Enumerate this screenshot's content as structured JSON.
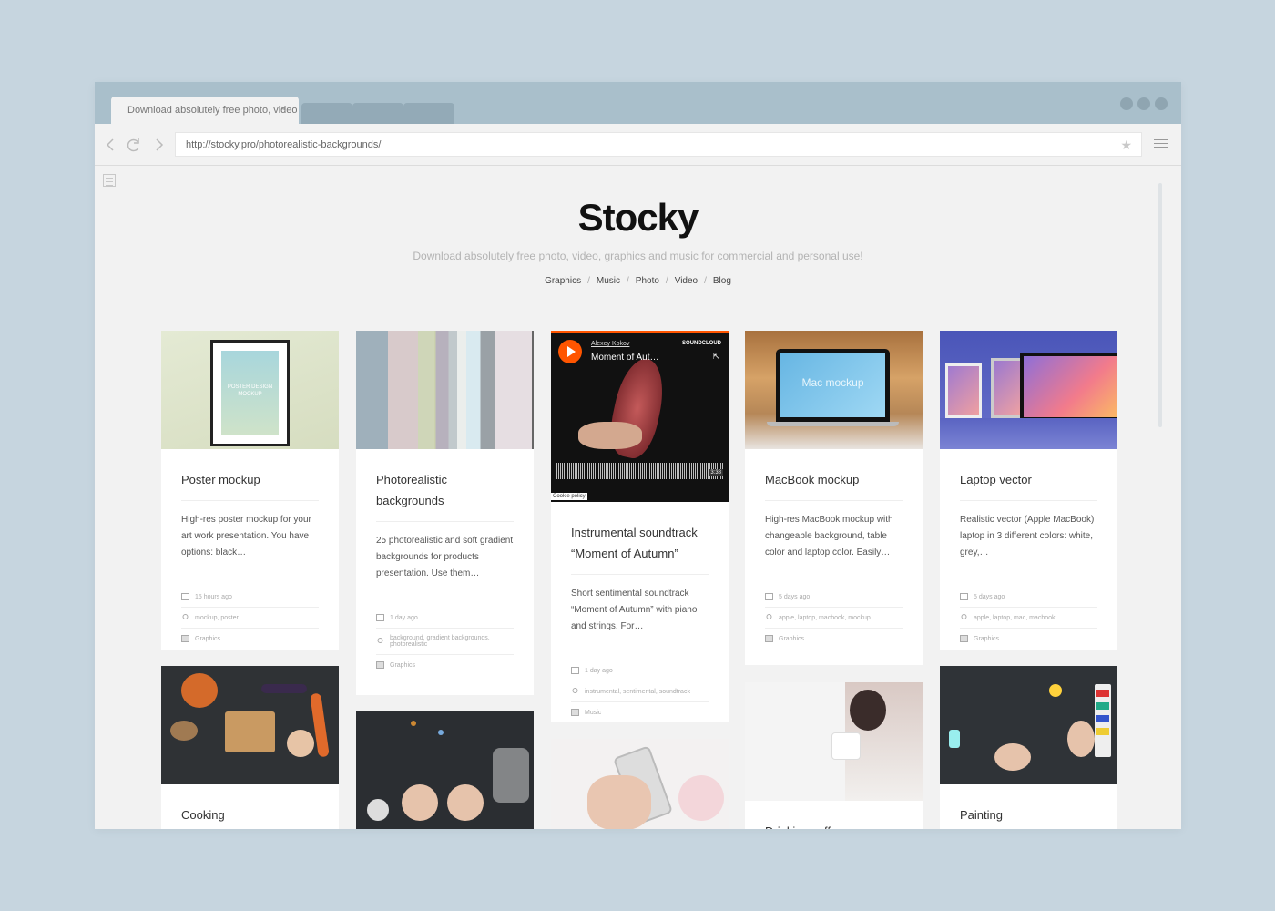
{
  "browser": {
    "tab_title": "Download absolutely free photo, video",
    "tab_close": "×",
    "url": "http://stocky.pro/photorealistic-backgrounds/"
  },
  "site": {
    "title": "Stocky",
    "tagline": "Download absolutely free photo, video, graphics and music for commercial and personal use!",
    "nav": [
      "Graphics",
      "Music",
      "Photo",
      "Video",
      "Blog"
    ],
    "nav_separator": "/"
  },
  "cards": [
    {
      "title": "Poster mockup",
      "desc": "High-res poster mockup for your art work presentation. You have options: black…",
      "time": "15 hours ago",
      "tags": "mockup, poster",
      "category": "Graphics",
      "poster_text_1": "POSTER DESIGN",
      "poster_text_2": "MOCKUP"
    },
    {
      "title": "Photorealistic backgrounds",
      "desc": "25 photorealistic and soft gradient backgrounds for products presentation. Use them…",
      "time": "1 day ago",
      "tags": "background, gradient backgrounds, photorealistic",
      "category": "Graphics"
    },
    {
      "title": "Instrumental soundtrack “Moment of Autumn”",
      "desc": "Short sentimental soundtrack “Moment of Autumn” with piano and strings. For…",
      "time": "1 day ago",
      "tags": "instrumental, sentimental, soundtrack",
      "category": "Music",
      "player": {
        "artist": "Alexey Kokov",
        "track": "Moment of Aut…",
        "brand": "SOUNDCLOUD",
        "duration": "3:38",
        "cookie": "Cookie policy"
      }
    },
    {
      "title": "MacBook mockup",
      "desc": "High-res MacBook mockup with changeable background, table color and laptop color. Easily…",
      "time": "5 days ago",
      "tags": "apple, laptop, macbook, mockup",
      "category": "Graphics",
      "screen_text": "Mac mockup"
    },
    {
      "title": "Laptop vector",
      "desc": "Realistic vector (Apple MacBook) laptop in 3 different colors: white, grey,…",
      "time": "5 days ago",
      "tags": "apple, laptop, mac, macbook",
      "category": "Graphics"
    },
    {
      "title": "Cooking"
    },
    {
      "title": "Drinking coffee"
    },
    {
      "title": "Painting"
    }
  ]
}
